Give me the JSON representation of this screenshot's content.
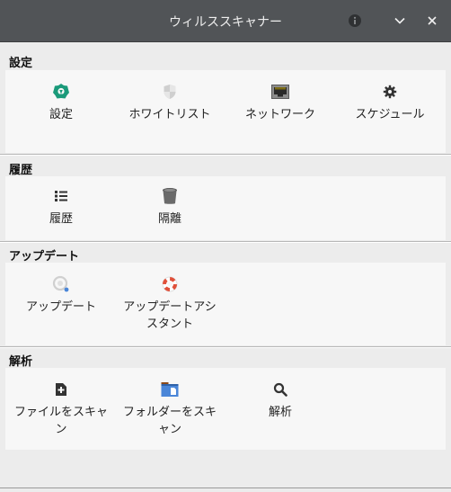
{
  "window": {
    "title": "ウィルススキャナー",
    "controls": [
      "info-icon",
      "minimize-icon",
      "close-icon"
    ]
  },
  "sections": {
    "settings": {
      "title": "設定",
      "items": [
        {
          "label": "設定",
          "icon": "scanner-settings-icon"
        },
        {
          "label": "ホワイトリスト",
          "icon": "shield-icon"
        },
        {
          "label": "ネットワーク",
          "icon": "network-port-icon"
        },
        {
          "label": "スケジュール",
          "icon": "gear-icon"
        }
      ]
    },
    "history": {
      "title": "履歴",
      "items": [
        {
          "label": "履歴",
          "icon": "list-icon"
        },
        {
          "label": "隔離",
          "icon": "trash-bin-icon"
        }
      ]
    },
    "update": {
      "title": "アップデート",
      "items": [
        {
          "label": "アップデート",
          "icon": "update-icon"
        },
        {
          "label": "アップデートアシスタント",
          "icon": "lifebuoy-icon"
        }
      ]
    },
    "analysis": {
      "title": "解析",
      "items": [
        {
          "label": "ファイルをスキャン",
          "icon": "add-file-icon"
        },
        {
          "label": "フォルダーをスキャン",
          "icon": "folder-icon"
        },
        {
          "label": "解析",
          "icon": "search-icon"
        }
      ]
    }
  },
  "colors": {
    "titlebar": "#515457",
    "accent_green": "#1a9a7a",
    "lifebuoy_red": "#e0503a",
    "folder_blue": "#4a86d8"
  }
}
